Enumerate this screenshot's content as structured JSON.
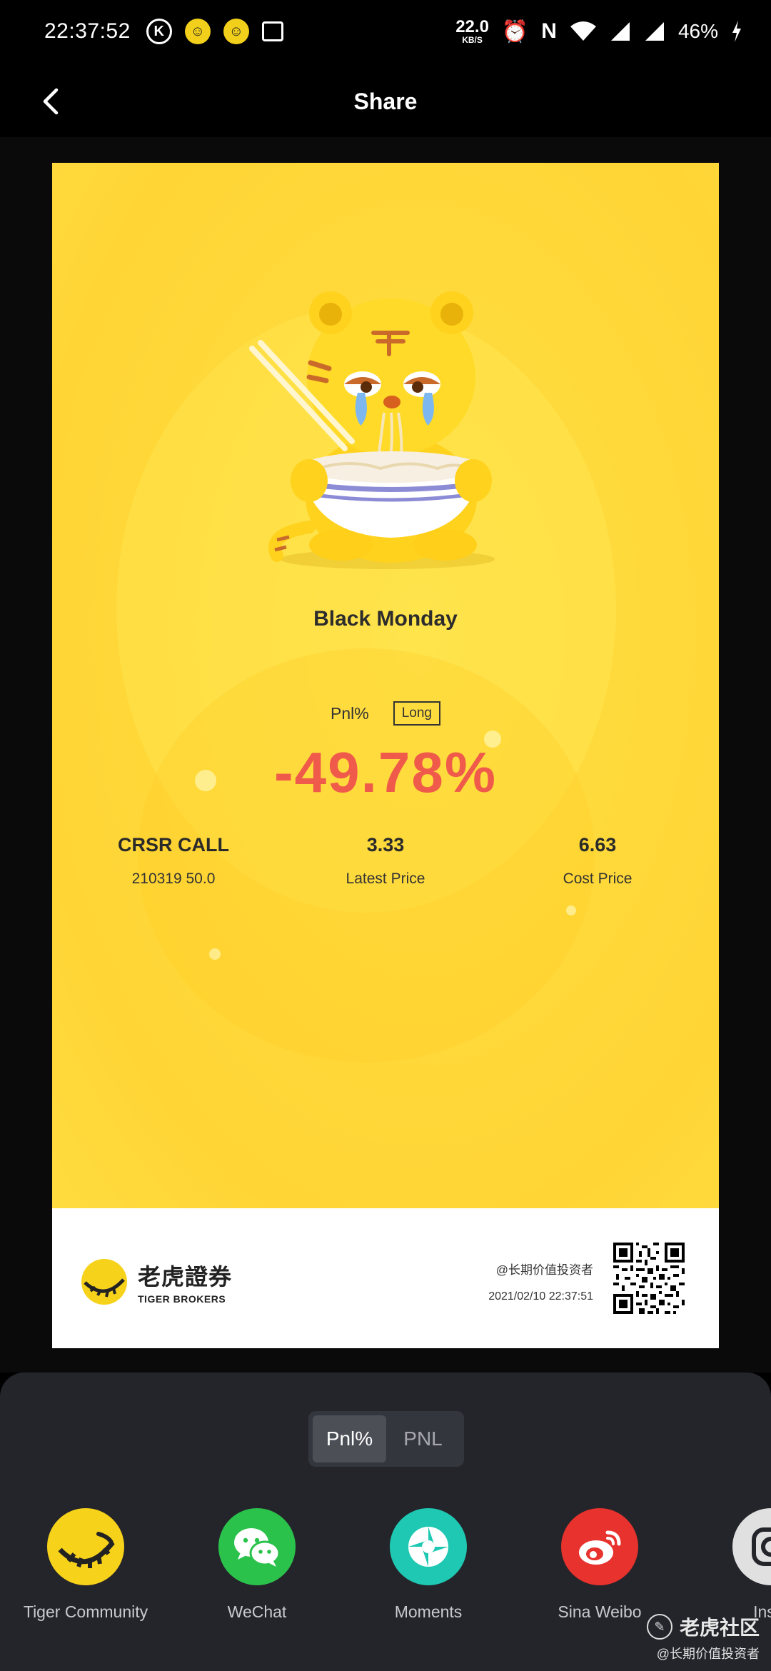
{
  "status_bar": {
    "time": "22:37:52",
    "net_speed_value": "22.0",
    "net_speed_unit": "KB/S",
    "battery": "46%"
  },
  "header": {
    "title": "Share"
  },
  "card": {
    "title": "Black Monday",
    "pnl_label": "Pnl%",
    "direction_badge": "Long",
    "pnl_value": "-49.78%",
    "symbol": "CRSR CALL",
    "contract": "210319 50.0",
    "latest_price": "3.33",
    "latest_price_label": "Latest Price",
    "cost_price": "6.63",
    "cost_price_label": "Cost Price",
    "brand_cn": "老虎證券",
    "brand_en": "TIGER BROKERS",
    "user": "@长期价值投资者",
    "date": "2021/02/10 22:37:51"
  },
  "toggle": {
    "options": [
      "Pnl%",
      "PNL"
    ],
    "selected": "Pnl%"
  },
  "share_targets": [
    {
      "label": "Tiger Community",
      "icon": "tiger-icon",
      "color": "#f6d21b"
    },
    {
      "label": "WeChat",
      "icon": "wechat-icon",
      "color": "#2bc24c"
    },
    {
      "label": "Moments",
      "icon": "moments-icon",
      "color": "#1ec8b2"
    },
    {
      "label": "Sina Weibo",
      "icon": "weibo-icon",
      "color": "#e8322d"
    },
    {
      "label": "Insta",
      "icon": "instagram-icon",
      "color": "#e0e0e0"
    }
  ],
  "watermark": {
    "title": "老虎社区",
    "subtitle": "@长期价值投资者"
  },
  "colors": {
    "pnl_negative": "#ef5a4a",
    "card_yellow": "#ffd93a",
    "sheet_bg": "#24252b"
  }
}
